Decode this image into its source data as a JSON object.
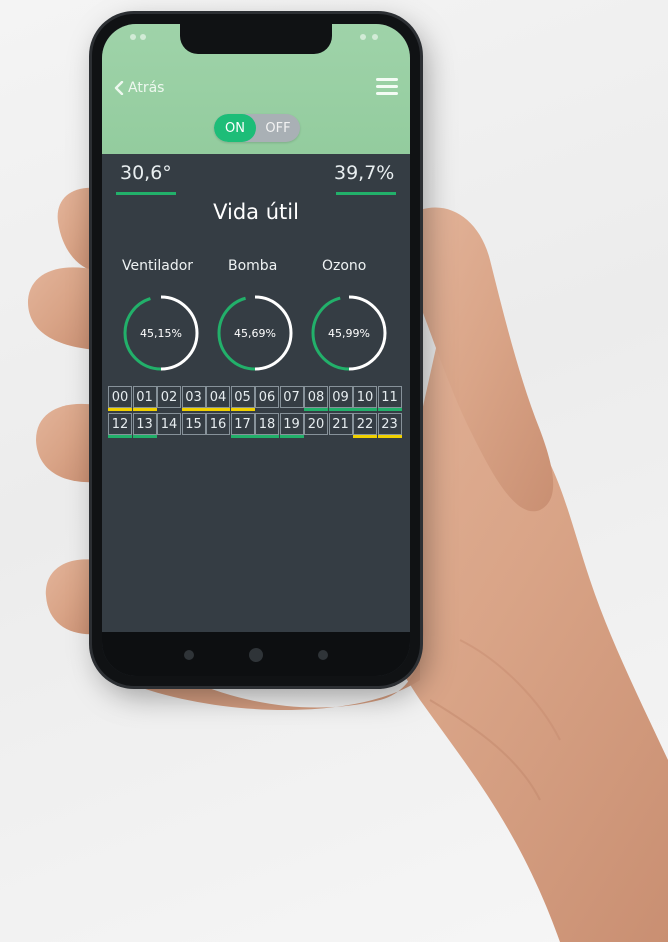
{
  "header": {
    "back_label": "Atrás",
    "toggle_on": "ON",
    "toggle_off": "OFF",
    "toggle_state": "ON"
  },
  "stats": {
    "temperature": "30,6°",
    "humidity": "39,7%"
  },
  "section_title": "Vida útil",
  "gauges": [
    {
      "label": "Ventilador",
      "value_text": "45,15%",
      "value": 45.15
    },
    {
      "label": "Bomba",
      "value_text": "45,69%",
      "value": 45.69
    },
    {
      "label": "Ozono",
      "value_text": "45,99%",
      "value": 45.99
    }
  ],
  "hours": [
    {
      "label": "00",
      "mark": "yellow"
    },
    {
      "label": "01",
      "mark": "yellow"
    },
    {
      "label": "02",
      "mark": "none"
    },
    {
      "label": "03",
      "mark": "yellow"
    },
    {
      "label": "04",
      "mark": "yellow"
    },
    {
      "label": "05",
      "mark": "yellow"
    },
    {
      "label": "06",
      "mark": "none"
    },
    {
      "label": "07",
      "mark": "none"
    },
    {
      "label": "08",
      "mark": "green"
    },
    {
      "label": "09",
      "mark": "green"
    },
    {
      "label": "10",
      "mark": "green"
    },
    {
      "label": "11",
      "mark": "green"
    },
    {
      "label": "12",
      "mark": "green"
    },
    {
      "label": "13",
      "mark": "green"
    },
    {
      "label": "14",
      "mark": "none"
    },
    {
      "label": "15",
      "mark": "none"
    },
    {
      "label": "16",
      "mark": "none"
    },
    {
      "label": "17",
      "mark": "green"
    },
    {
      "label": "18",
      "mark": "green"
    },
    {
      "label": "19",
      "mark": "green"
    },
    {
      "label": "20",
      "mark": "none"
    },
    {
      "label": "21",
      "mark": "none"
    },
    {
      "label": "22",
      "mark": "yellow"
    },
    {
      "label": "23",
      "mark": "yellow"
    }
  ],
  "colors": {
    "header_green": "#9fd3a9",
    "on_green": "#1dbd78",
    "accent_green": "#22b06a",
    "mark_yellow": "#f0d000",
    "screen_bg": "#353d44"
  },
  "icons": {
    "back": "chevron-left-icon",
    "menu": "hamburger-menu-icon"
  }
}
